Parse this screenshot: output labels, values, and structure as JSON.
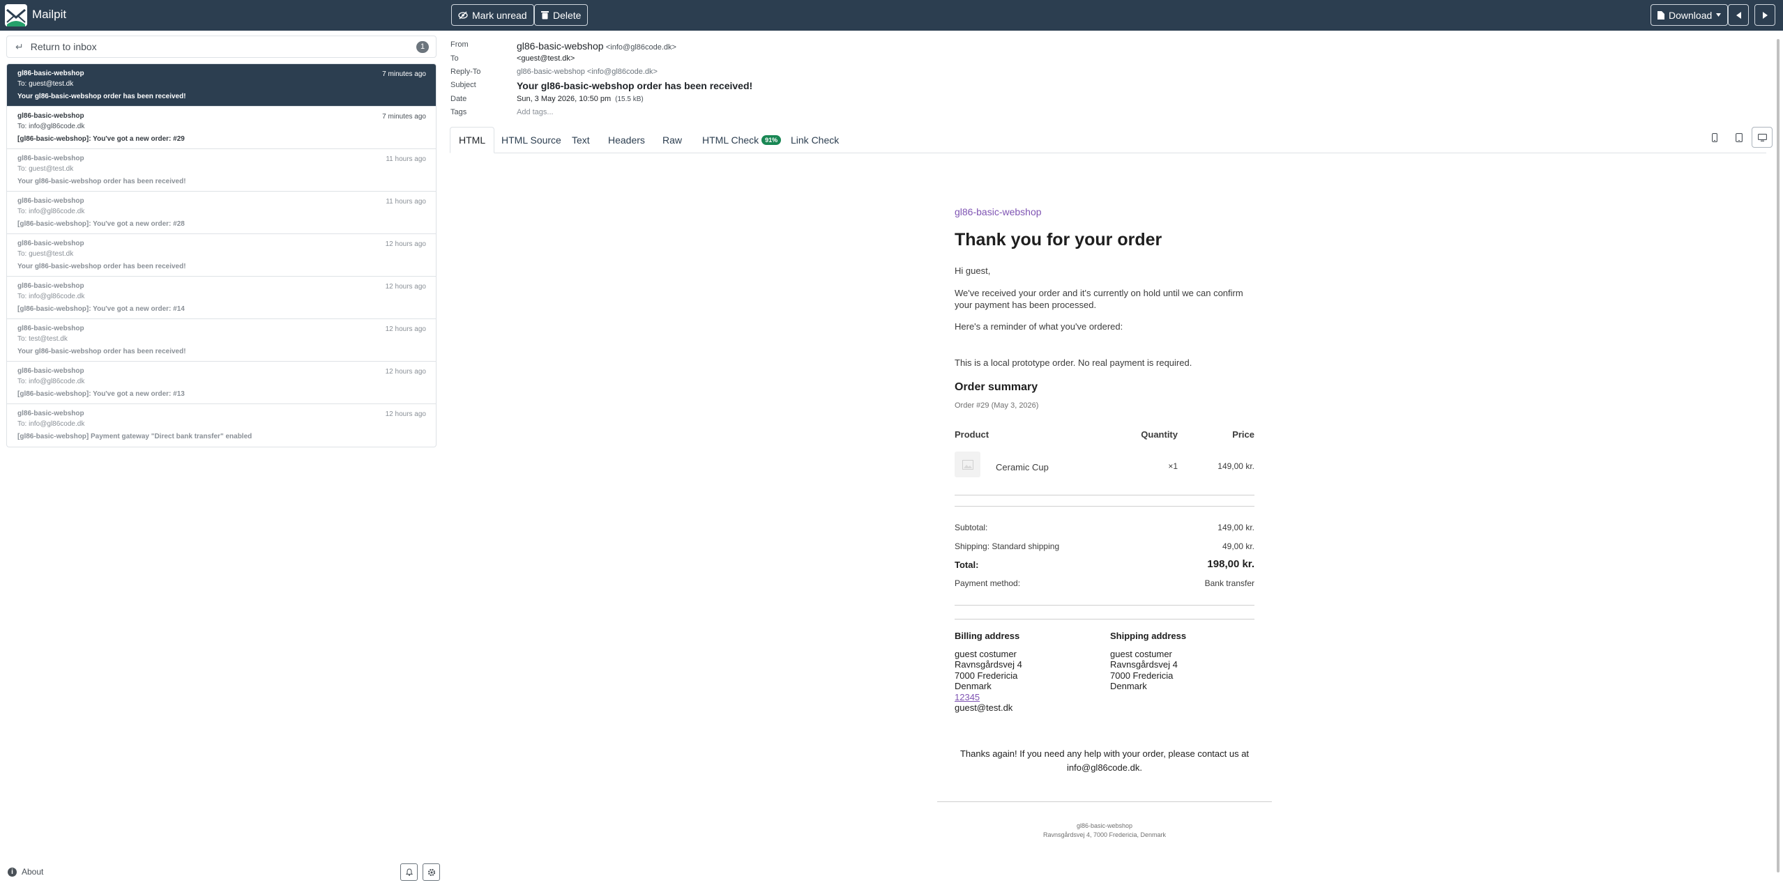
{
  "app": {
    "title": "Mailpit"
  },
  "toolbar": {
    "mark_unread": "Mark unread",
    "delete": "Delete",
    "download": "Download"
  },
  "sidebar": {
    "return_label": "Return to inbox",
    "badge": "1",
    "messages": [
      {
        "from": "gl86-basic-webshop",
        "to": "To: guest@test.dk",
        "subject": "Your gl86-basic-webshop order has been received!",
        "time": "7 minutes ago"
      },
      {
        "from": "gl86-basic-webshop",
        "to": "To: info@gl86code.dk",
        "subject": "[gl86-basic-webshop]: You've got a new order: #29",
        "time": "7 minutes ago"
      },
      {
        "from": "gl86-basic-webshop",
        "to": "To: guest@test.dk",
        "subject": "Your gl86-basic-webshop order has been received!",
        "time": "11 hours ago"
      },
      {
        "from": "gl86-basic-webshop",
        "to": "To: info@gl86code.dk",
        "subject": "[gl86-basic-webshop]: You've got a new order: #28",
        "time": "11 hours ago"
      },
      {
        "from": "gl86-basic-webshop",
        "to": "To: guest@test.dk",
        "subject": "Your gl86-basic-webshop order has been received!",
        "time": "12 hours ago"
      },
      {
        "from": "gl86-basic-webshop",
        "to": "To: info@gl86code.dk",
        "subject": "[gl86-basic-webshop]: You've got a new order: #14",
        "time": "12 hours ago"
      },
      {
        "from": "gl86-basic-webshop",
        "to": "To: test@test.dk",
        "subject": "Your gl86-basic-webshop order has been received!",
        "time": "12 hours ago"
      },
      {
        "from": "gl86-basic-webshop",
        "to": "To: info@gl86code.dk",
        "subject": "[gl86-basic-webshop]: You've got a new order: #13",
        "time": "12 hours ago"
      },
      {
        "from": "gl86-basic-webshop",
        "to": "To: info@gl86code.dk",
        "subject": "[gl86-basic-webshop] Payment gateway \"Direct bank transfer\" enabled",
        "time": "12 hours ago"
      }
    ],
    "about": "About"
  },
  "headers": {
    "labels": {
      "from": "From",
      "to": "To",
      "reply_to": "Reply-To",
      "subject": "Subject",
      "date": "Date",
      "tags": "Tags"
    },
    "from_name": "gl86-basic-webshop",
    "from_email": "<info@gl86code.dk>",
    "to": "<guest@test.dk>",
    "reply_to": "gl86-basic-webshop <info@gl86code.dk>",
    "subject": "Your gl86-basic-webshop order has been received!",
    "date": "Sun, 3 May 2026, 10:50 pm",
    "size": "(15.5 kB)",
    "tags_placeholder": "Add tags..."
  },
  "tabs": {
    "html": "HTML",
    "html_source": "HTML Source",
    "text": "Text",
    "headers": "Headers",
    "raw": "Raw",
    "html_check": "HTML Check",
    "html_check_score": "91%",
    "link_check": "Link Check"
  },
  "email": {
    "brand": "gl86-basic-webshop",
    "heading": "Thank you for your order",
    "greeting": "Hi guest,",
    "intro": "We've received your order and it's currently on hold until we can confirm your payment has been processed.",
    "reminder": "Here's a reminder of what you've ordered:",
    "prototype_note": "This is a local prototype order. No real payment is required.",
    "summary_title": "Order summary",
    "order_meta": "Order #29 (May 3, 2026)",
    "table_headers": {
      "product": "Product",
      "quantity": "Quantity",
      "price": "Price"
    },
    "item": {
      "name": "Ceramic Cup",
      "qty": "×1",
      "price": "149,00 kr."
    },
    "totals": {
      "subtotal_label": "Subtotal:",
      "subtotal_value": "149,00 kr.",
      "shipping_label": "Shipping: Standard shipping",
      "shipping_value": "49,00 kr.",
      "total_label": "Total:",
      "total_value": "198,00 kr.",
      "payment_label": "Payment method:",
      "payment_value": "Bank transfer"
    },
    "billing": {
      "title": "Billing address",
      "name": "guest costumer",
      "street": "Ravnsgårdsvej 4",
      "city": "7000 Fredericia",
      "country": "Denmark",
      "phone": "12345",
      "email": "guest@test.dk"
    },
    "shipping": {
      "title": "Shipping address",
      "name": "guest costumer",
      "street": "Ravnsgårdsvej 4",
      "city": "7000 Fredericia",
      "country": "Denmark"
    },
    "thanks": "Thanks again! If you need any help with your order, please contact us at info@gl86code.dk.",
    "footer_name": "gl86-basic-webshop",
    "footer_address": "Ravnsgårdsvej 4, 7000 Fredericia, Denmark"
  },
  "colors": {
    "topbar": "#2c3e50",
    "brand_purple": "#7f54b3",
    "badge_green": "#198754"
  }
}
